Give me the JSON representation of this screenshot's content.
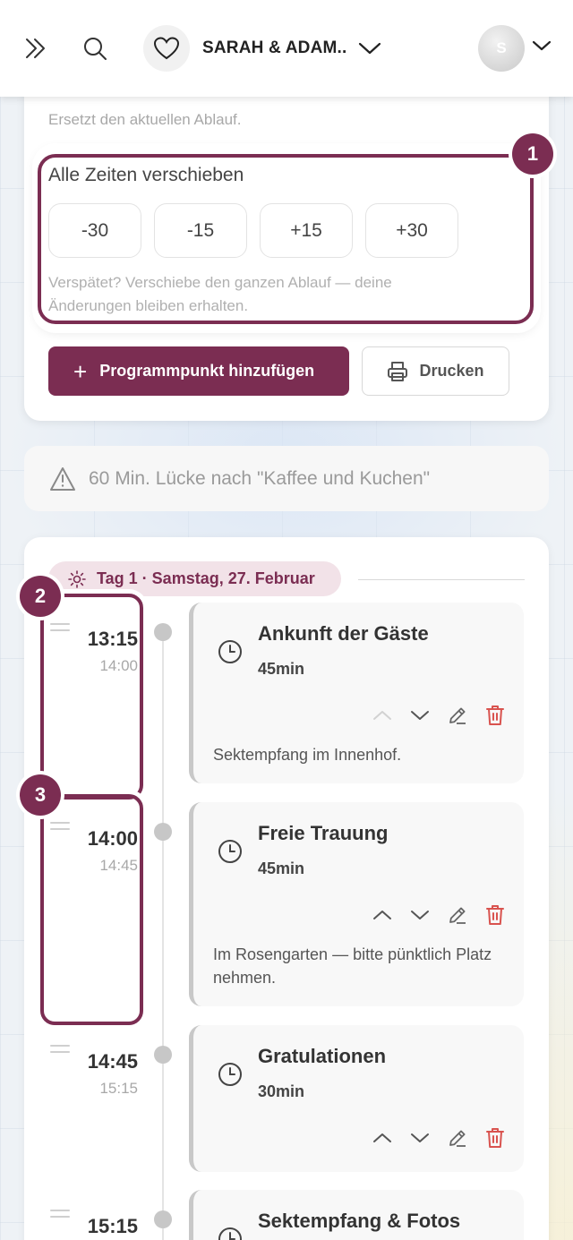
{
  "header": {
    "event_name": "SARAH & ADAM...",
    "avatar_initial": "S"
  },
  "top_card": {
    "replace_note": "Ersetzt den aktuellen Ablauf.",
    "shift": {
      "title": "Alle Zeiten verschieben",
      "buttons": [
        "-30",
        "-15",
        "+15",
        "+30"
      ],
      "help": "Verspätet? Verschiebe den ganzen Ablauf — deine Änderungen bleiben erhalten."
    },
    "add_label": "Programmpunkt hinzufügen",
    "print_label": "Drucken"
  },
  "gap_notice": "60 Min. Lücke nach \"Kaffee und Kuchen\"",
  "day": {
    "label": "Tag 1 · Samstag, 27. Februar"
  },
  "entries": [
    {
      "start": "13:15",
      "end": "14:00",
      "title": "Ankunft der Gäste",
      "duration": "45min",
      "note": "Sektempfang im Innenhof."
    },
    {
      "start": "14:00",
      "end": "14:45",
      "title": "Freie Trauung",
      "duration": "45min",
      "note": "Im Rosengarten — bitte pünktlich Platz nehmen."
    },
    {
      "start": "14:45",
      "end": "15:15",
      "title": "Gratulationen",
      "duration": "30min",
      "note": ""
    },
    {
      "start": "15:15",
      "end": "",
      "title": "Sektempfang & Fotos",
      "duration": "",
      "note": ""
    }
  ],
  "highlights": [
    "1",
    "2",
    "3"
  ],
  "colors": {
    "accent": "#7b2d52",
    "accent_soft": "#f2e2e8",
    "delete": "#d9534f"
  },
  "icons": {
    "expand": "double-chevron-right-icon",
    "search": "search-icon",
    "heart": "heart-icon",
    "warning": "warning-icon",
    "sun": "sun-icon",
    "clock": "clock-icon",
    "edit": "edit-icon",
    "delete": "trash-icon",
    "print": "printer-icon"
  }
}
